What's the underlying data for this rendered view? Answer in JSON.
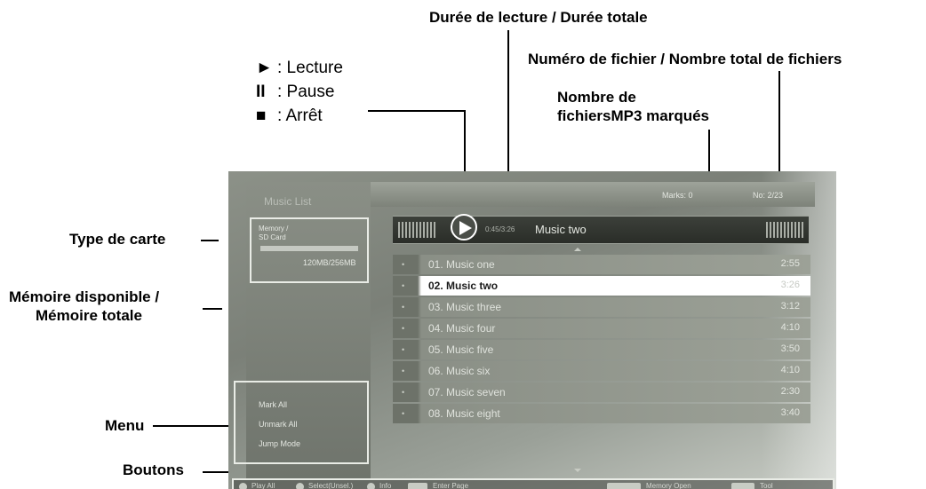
{
  "callouts": {
    "duration": "Durée de lecture / Durée totale",
    "file_number": "Numéro de fichier / Nombre total de fichiers",
    "marked_line1": "Nombre de",
    "marked_line2": "fichiersMP3 marqués",
    "card_type": "Type de carte",
    "memory_line1": "Mémoire disponible /",
    "memory_line2": "Mémoire totale",
    "menu": "Menu",
    "buttons": "Boutons"
  },
  "legend": [
    {
      "icon": "play-icon",
      "symbol": "►",
      "label": ": Lecture"
    },
    {
      "icon": "pause-icon",
      "symbol": "II",
      "label": ": Pause"
    },
    {
      "icon": "stop-icon",
      "symbol": "■",
      "label": ": Arrêt"
    }
  ],
  "screen": {
    "panel_title": "Music List",
    "top_bar": {
      "marks": "Marks: 0",
      "file_no": "No: 2/23"
    },
    "card": {
      "type_line1": "Memory /",
      "type_line2": "SD Card",
      "memory": "120MB/256MB"
    },
    "now_playing": {
      "time": "0:45/3:26",
      "title": "Music two"
    },
    "tracks": [
      {
        "name": "01. Music one",
        "duration": "2:55",
        "active": false
      },
      {
        "name": "02. Music two",
        "duration": "3:26",
        "active": true
      },
      {
        "name": "03. Music three",
        "duration": "3:12",
        "active": false
      },
      {
        "name": "04. Music four",
        "duration": "4:10",
        "active": false
      },
      {
        "name": "05. Music five",
        "duration": "3:50",
        "active": false
      },
      {
        "name": "06. Music six",
        "duration": "4:10",
        "active": false
      },
      {
        "name": "07. Music seven",
        "duration": "2:30",
        "active": false
      },
      {
        "name": "08. Music eight",
        "duration": "3:40",
        "active": false
      }
    ],
    "menu_items": [
      "Mark All",
      "Unmark All",
      "Jump Mode"
    ],
    "buttons": {
      "play": "Play All",
      "select": "Select(Unsel.)",
      "info": "Info",
      "enter": "Enter Page",
      "memory": "Memory Open",
      "tool": "Tool"
    }
  }
}
